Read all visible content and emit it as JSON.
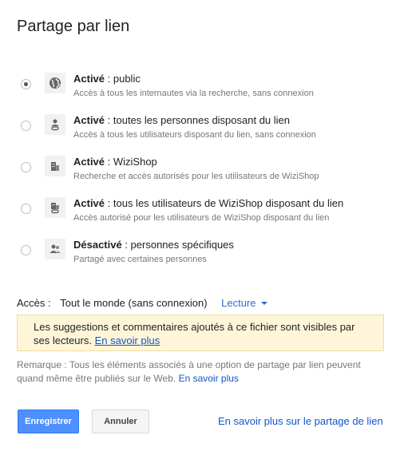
{
  "dialog": {
    "title": "Partage par lien"
  },
  "options": [
    {
      "title_bold": "Activé",
      "title_rest": " : public",
      "description": "Accès à tous les internautes via la recherche, sans connexion",
      "icon": "globe-icon",
      "selected": true
    },
    {
      "title_bold": "Activé",
      "title_rest": " : toutes les personnes disposant du lien",
      "description": "Accès à tous les utilisateurs disposant du lien, sans connexion",
      "icon": "person-link-icon",
      "selected": false
    },
    {
      "title_bold": "Activé",
      "title_rest": " : WiziShop",
      "description": "Recherche et accès autorisés pour les utilisateurs de WiziShop",
      "icon": "building-icon",
      "selected": false
    },
    {
      "title_bold": "Activé",
      "title_rest": " : tous les utilisateurs de WiziShop disposant du lien",
      "description": "Accès autorisé pour les utilisateurs de WiziShop disposant du lien",
      "icon": "building-link-icon",
      "selected": false
    },
    {
      "title_bold": "Désactivé",
      "title_rest": " : personnes spécifiques",
      "description": "Partagé avec certaines personnes",
      "icon": "people-icon",
      "selected": false
    }
  ],
  "access": {
    "label": "Accès :",
    "value": "Tout le monde (sans connexion)",
    "mode": "Lecture"
  },
  "notice": {
    "text": "Les suggestions et commentaires ajoutés à ce fichier sont visibles par ses lecteurs.",
    "link": "En savoir plus"
  },
  "remark": {
    "text": "Remarque : Tous les éléments associés à une option de partage par lien peuvent quand même être publiés sur le Web.",
    "link": "En savoir plus"
  },
  "buttons": {
    "save": "Enregistrer",
    "cancel": "Annuler"
  },
  "help_link": "En savoir plus sur le partage de lien",
  "colors": {
    "accent": "#4d90fe",
    "link": "#1155cc",
    "notice_bg": "#fff6d9"
  }
}
